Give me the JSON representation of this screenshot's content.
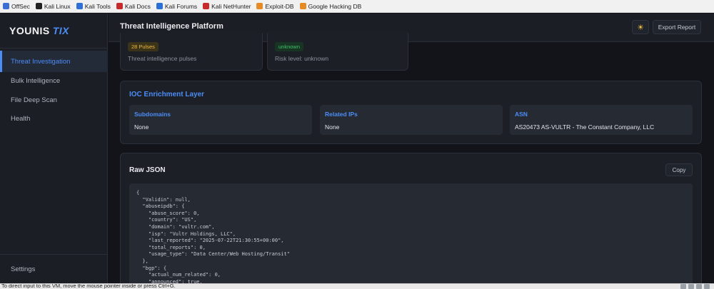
{
  "bookmarks": [
    {
      "label": "OffSec",
      "icon": "offsec-icon",
      "color": "#3b6fd4"
    },
    {
      "label": "Kali Linux",
      "icon": "kali-dragon-icon",
      "color": "#222222"
    },
    {
      "label": "Kali Tools",
      "icon": "kali-tools-icon",
      "color": "#2f6fd6"
    },
    {
      "label": "Kali Docs",
      "icon": "kali-docs-icon",
      "color": "#c72a2a"
    },
    {
      "label": "Kali Forums",
      "icon": "kali-forums-icon",
      "color": "#2a6fd6"
    },
    {
      "label": "Kali NetHunter",
      "icon": "nethunter-icon",
      "color": "#c72a2a"
    },
    {
      "label": "Exploit-DB",
      "icon": "exploitdb-icon",
      "color": "#e58a24"
    },
    {
      "label": "Google Hacking DB",
      "icon": "ghdb-icon",
      "color": "#e58a24"
    }
  ],
  "sidebar": {
    "logo_main": "YOUNIS",
    "logo_accent": "TIX",
    "items": [
      {
        "label": "Threat Investigation",
        "active": true
      },
      {
        "label": "Bulk Intelligence",
        "active": false
      },
      {
        "label": "File Deep Scan",
        "active": false
      },
      {
        "label": "Health",
        "active": false
      }
    ],
    "settings_label": "Settings"
  },
  "header": {
    "title": "Threat Intelligence Platform",
    "theme_icon": "sun-icon",
    "export_label": "Export Report"
  },
  "summary": {
    "pulses_badge": "28 Pulses",
    "pulses_caption": "Threat intelligence pulses",
    "risk_badge": "unknown",
    "risk_caption": "Risk level: unknown"
  },
  "ioc": {
    "title": "IOC Enrichment Layer",
    "subdomains_label": "Subdomains",
    "subdomains_value": "None",
    "related_ips_label": "Related IPs",
    "related_ips_value": "None",
    "asn_label": "ASN",
    "asn_value": "AS20473 AS-VULTR - The Constant Company, LLC"
  },
  "raw_json": {
    "title": "Raw JSON",
    "copy_label": "Copy",
    "content": "{\n  \"Validin\": null,\n  \"abuseipdb\": {\n    \"abuse_score\": 0,\n    \"country\": \"US\",\n    \"domain\": \"vultr.com\",\n    \"isp\": \"Vultr Holdings, LLC\",\n    \"last_reported\": \"2025-07-22T21:30:55+00:00\",\n    \"total_reports\": 0,\n    \"usage_type\": \"Data Center/Web Hosting/Transit\"\n  },\n  \"bgp\": {\n    \"actual_num_related\": 0,\n    \"announced\": true,"
  },
  "vm_bar": {
    "text": "To direct input to this VM, move the mouse pointer inside or press Ctrl+G."
  },
  "colors": {
    "accent": "#4c8df6",
    "background": "#12141a",
    "panel": "#1c1f26"
  }
}
